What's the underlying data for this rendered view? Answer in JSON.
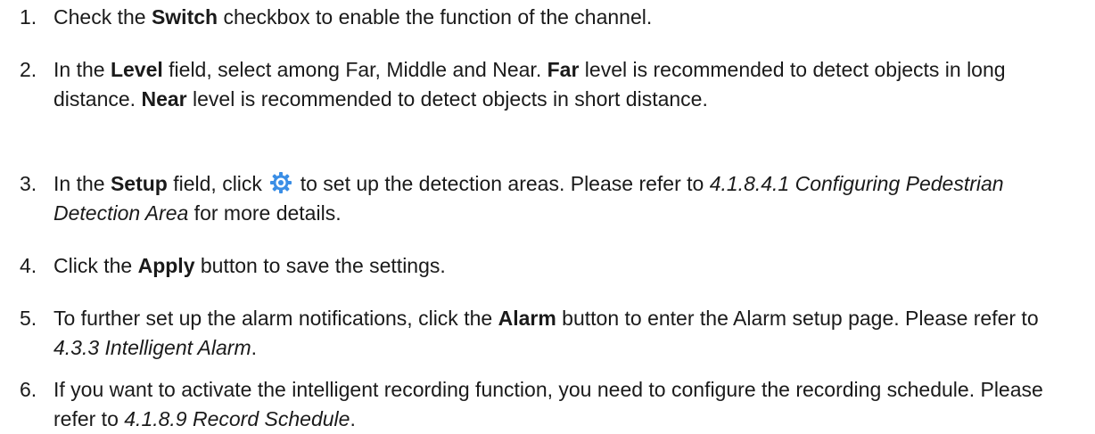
{
  "steps": [
    {
      "number": "1.",
      "text_1": "Check the ",
      "bold_1": "Switch",
      "text_2": " checkbox to enable the function of the channel."
    },
    {
      "number": "2.",
      "text_1": "In the ",
      "bold_1": "Level",
      "text_2": " field, select among Far, Middle and Near. ",
      "bold_2": "Far",
      "text_3": " level is recommended to detect objects in long distance. ",
      "bold_3": "Near",
      "text_4": " level is recommended to detect objects in short distance."
    },
    {
      "number": "3.",
      "text_1": "In the ",
      "bold_1": "Setup",
      "text_2": " field, click ",
      "icon": "gear-icon",
      "text_3": " to set up the detection areas. Please refer to ",
      "italic_1": "4.1.8.4.1 Configuring Pedestrian Detection Area",
      "text_4": " for more details."
    },
    {
      "number": "4.",
      "text_1": "Click the ",
      "bold_1": "Apply",
      "text_2": " button to save the settings."
    },
    {
      "number": "5.",
      "text_1": "To further set up the alarm notifications, click the ",
      "bold_1": "Alarm",
      "text_2": " button to enter the Alarm setup page. Please refer to ",
      "italic_1": "4.3.3 Intelligent Alarm",
      "text_3": "."
    },
    {
      "number": "6.",
      "text_1": "If you want to activate the intelligent recording function, you need to configure the recording schedule. Please refer to ",
      "italic_1": "4.1.8.9 Record Schedule",
      "text_2": "."
    }
  ],
  "colors": {
    "text": "#1a1a1a",
    "icon_blue": "#3a8ee6"
  }
}
